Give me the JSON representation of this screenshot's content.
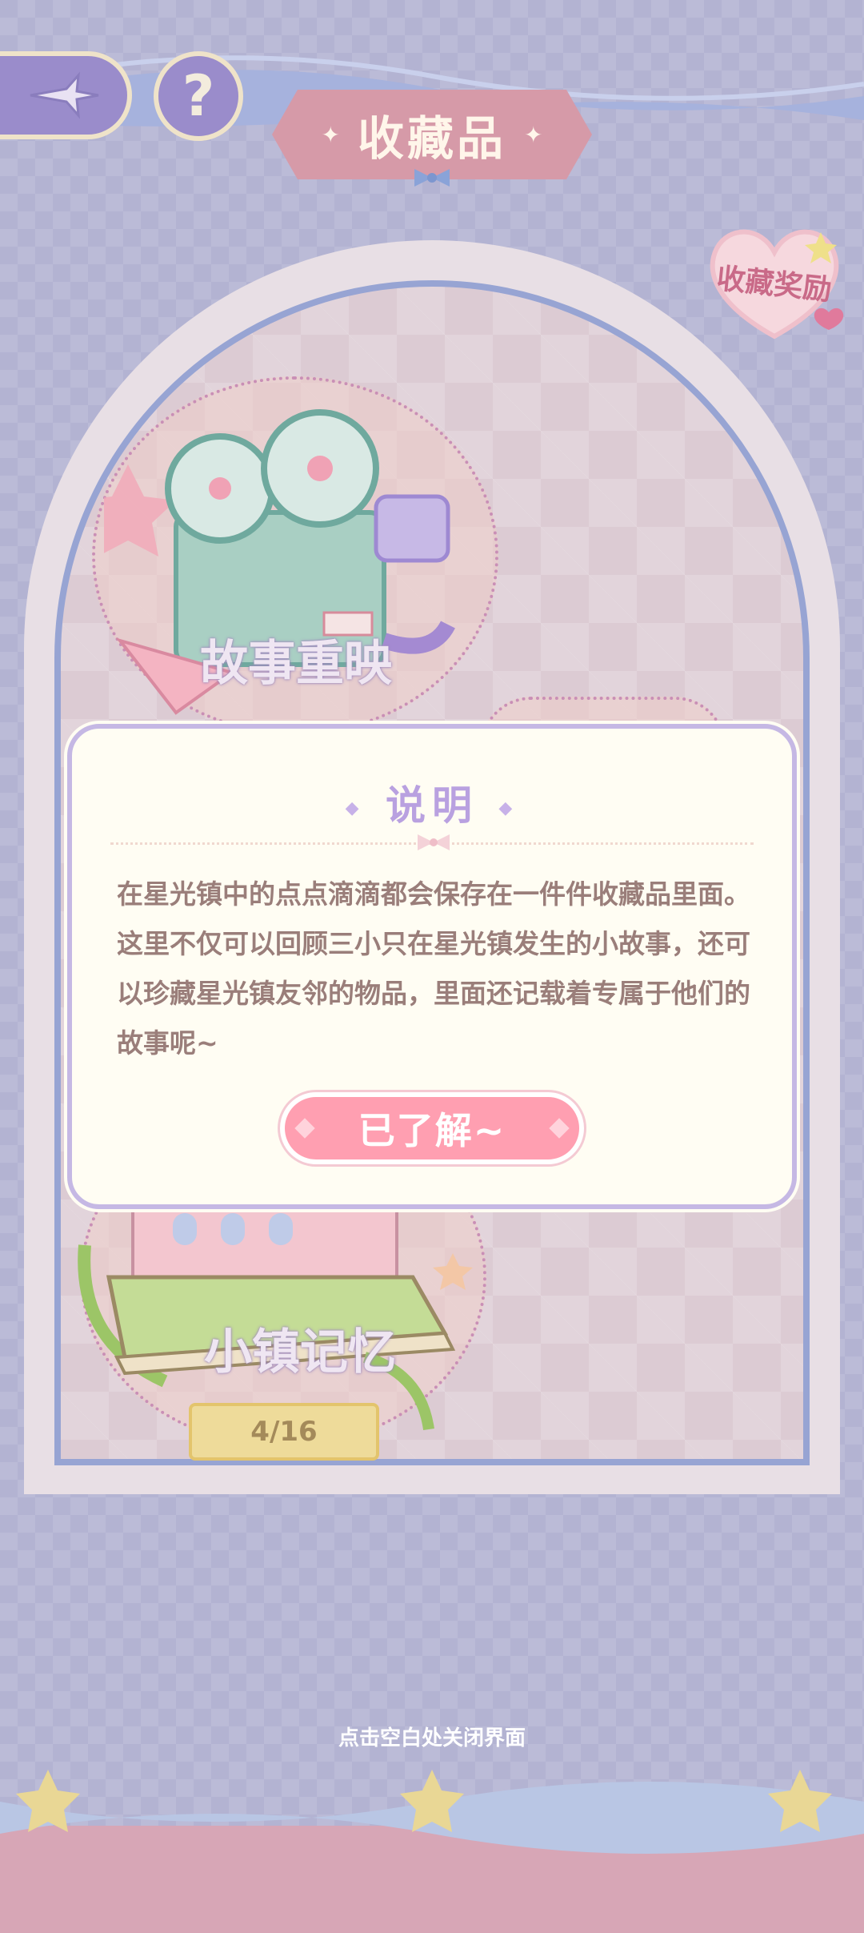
{
  "header": {
    "title": "收藏品",
    "back_icon": "compass-star-icon",
    "help_label": "?"
  },
  "reward_badge": {
    "label": "收藏奖励"
  },
  "collections": [
    {
      "name": "故事重映",
      "art": "film-projector-icon"
    },
    {
      "name": "小镇记忆",
      "art": "town-book-icon",
      "progress": "4/16"
    }
  ],
  "dialog": {
    "title": "说明",
    "body": "在星光镇中的点点滴滴都会保存在一件件收藏品里面。这里不仅可以回顾三小只在星光镇发生的小故事，还可以珍藏星光镇友邻的物品，里面还记载着专属于他们的故事呢~",
    "confirm_label": "已了解~"
  },
  "footer": {
    "close_hint": "点击空白处关闭界面"
  },
  "colors": {
    "accent_pink": "#ff9fb1",
    "title_purple": "#b9a1e0",
    "body_text": "#9a7e7a",
    "dialog_bg": "#fffdf3"
  }
}
